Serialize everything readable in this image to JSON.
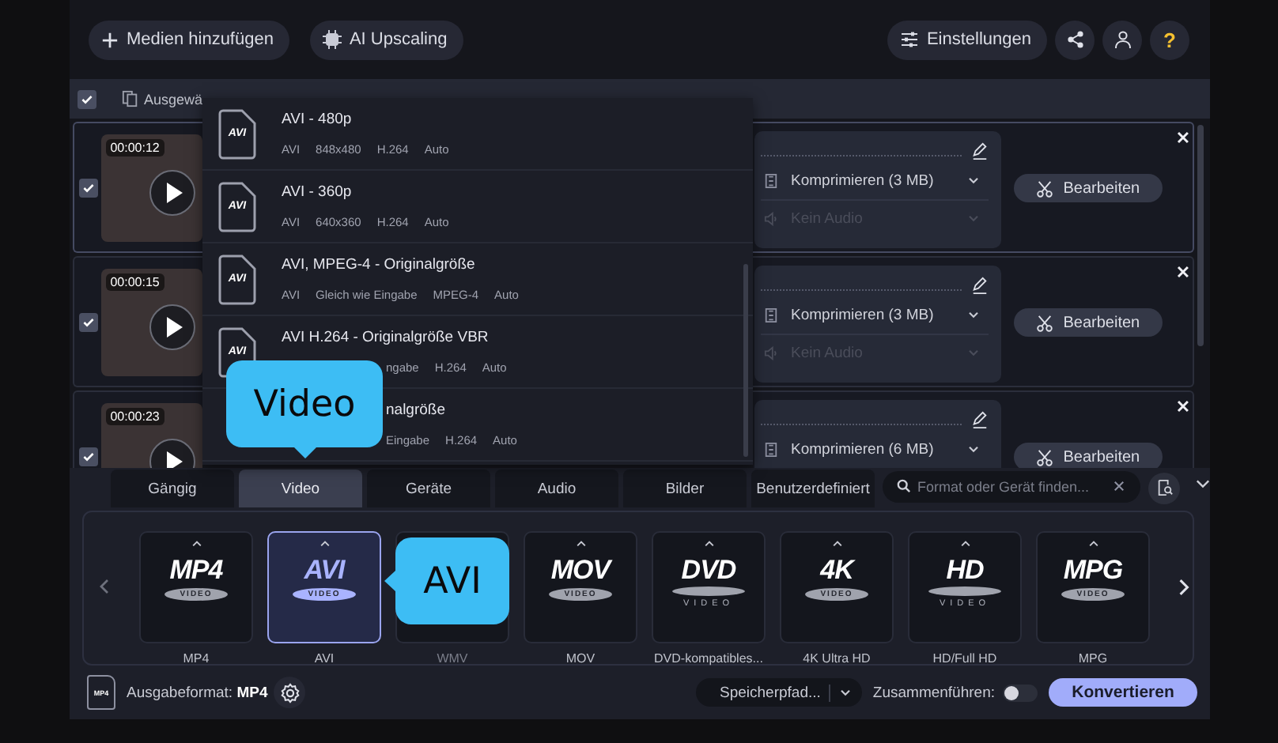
{
  "toolbar": {
    "add_button": "Medien hinzufügen",
    "upscale_button": "AI Upscaling",
    "settings_button": "Einstellungen",
    "help_button": "?"
  },
  "selection_bar": {
    "checked": true,
    "label": "Ausgewä"
  },
  "files": [
    {
      "checked": true,
      "selected": true,
      "duration": "00:00:12",
      "compression": "Komprimieren (3 MB)",
      "audio": "Kein Audio",
      "edit_button": "Bearbeiten"
    },
    {
      "checked": true,
      "selected": false,
      "duration": "00:00:15",
      "compression": "Komprimieren (3 MB)",
      "audio": "Kein Audio",
      "edit_button": "Bearbeiten"
    },
    {
      "checked": true,
      "selected": false,
      "duration": "00:00:23",
      "compression": "Komprimieren (6 MB)",
      "edit_button": "Bearbeiten"
    }
  ],
  "preset_dropdown": [
    {
      "kind": "full",
      "icon_label": "AVI",
      "title": "AVI - 480p",
      "meta": [
        "AVI",
        "848x480",
        "H.264",
        "Auto"
      ]
    },
    {
      "kind": "full",
      "icon_label": "AVI",
      "title": "AVI - 360p",
      "meta": [
        "AVI",
        "640x360",
        "H.264",
        "Auto"
      ]
    },
    {
      "kind": "full",
      "icon_label": "AVI",
      "title": "AVI, MPEG-4 - Originalgröße",
      "meta": [
        "AVI",
        "Gleich wie Eingabe",
        "MPEG-4",
        "Auto"
      ]
    },
    {
      "kind": "meta_covered",
      "icon_label": "AVI",
      "title": "AVI H.264 - Originalgröße VBR",
      "meta": [
        "ngabe",
        "H.264",
        "Auto"
      ]
    },
    {
      "kind": "covered",
      "title": "nalgröße",
      "meta": [
        "Eingabe",
        "H.264",
        "Auto"
      ]
    }
  ],
  "format_tabs": [
    {
      "label": "Gängig",
      "selected": false
    },
    {
      "label": "Video",
      "selected": true
    },
    {
      "label": "Geräte",
      "selected": false
    },
    {
      "label": "Audio",
      "selected": false
    },
    {
      "label": "Bilder",
      "selected": false
    },
    {
      "label": "Benutzerdefiniert",
      "selected": false
    }
  ],
  "search": {
    "placeholder": "Format oder Gerät finden..."
  },
  "formats": [
    {
      "kind": "badge",
      "logo": "MP4",
      "logo_sub": "VIDEO",
      "label": "MP4",
      "selected": false
    },
    {
      "kind": "badge",
      "logo": "AVI",
      "logo_sub": "VIDEO",
      "label": "AVI",
      "selected": true
    },
    {
      "kind": "covered",
      "label": "WMV",
      "selected": false
    },
    {
      "kind": "badge",
      "logo": "MOV",
      "logo_sub": "VIDEO",
      "label": "MOV",
      "selected": false
    },
    {
      "kind": "disc",
      "logo": "DVD",
      "logo_sub": "VIDEO",
      "label": "DVD-kompatibles...",
      "selected": false
    },
    {
      "kind": "badge",
      "logo": "4K",
      "logo_sub": "VIDEO",
      "label": "4K Ultra HD",
      "selected": false
    },
    {
      "kind": "disc",
      "logo": "HD",
      "logo_sub": "VIDEO",
      "label": "HD/Full HD",
      "selected": false
    },
    {
      "kind": "badge",
      "logo": "MPG",
      "logo_sub": "VIDEO",
      "label": "MPG",
      "selected": false
    }
  ],
  "bottom_bar": {
    "format_icon_label": "MP4",
    "format_label": "Ausgabeformat: **MP4**",
    "save_path": "Speicherpfad...",
    "merge_label": "Zusammenführen:",
    "merge_on": false,
    "convert_button": "Konvertieren"
  },
  "tooltips": [
    {
      "kind": "down",
      "text": "Video"
    },
    {
      "kind": "left",
      "text": "AVI"
    }
  ]
}
